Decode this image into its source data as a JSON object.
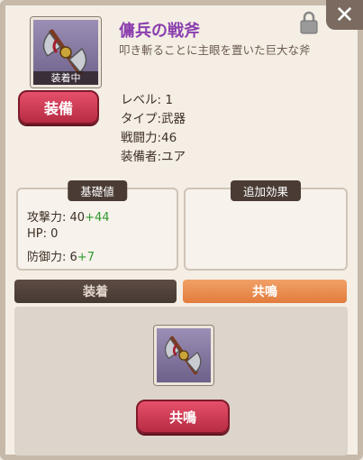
{
  "item": {
    "name": "傭兵の戦斧",
    "description": "叩き斬ることに主眼を置いた巨大な斧",
    "equipped_tag": "装着中"
  },
  "actions": {
    "equip_label": "装備",
    "resonate_label": "共鳴",
    "close_icon": "close-icon",
    "lock_icon": "lock-icon"
  },
  "stats": {
    "level": "レベル: 1",
    "type": "タイプ:武器",
    "power": "戦闘力:46",
    "owner": "装備者:ユア"
  },
  "base_values": {
    "label": "基礎値",
    "attack": "攻撃力: 40",
    "attack_bonus": "+44",
    "hp": "HP: 0",
    "defense": "防御力: 6",
    "defense_bonus": "+7"
  },
  "extra_effects": {
    "label": "追加効果"
  },
  "tabs": [
    {
      "label": "装着",
      "active": false
    },
    {
      "label": "共鳴",
      "active": true
    }
  ],
  "colors": {
    "title": "#8b3fae",
    "bonus": "#2e9a2e",
    "active_tab": "#e27c3d",
    "button_red": "#c93a52"
  }
}
